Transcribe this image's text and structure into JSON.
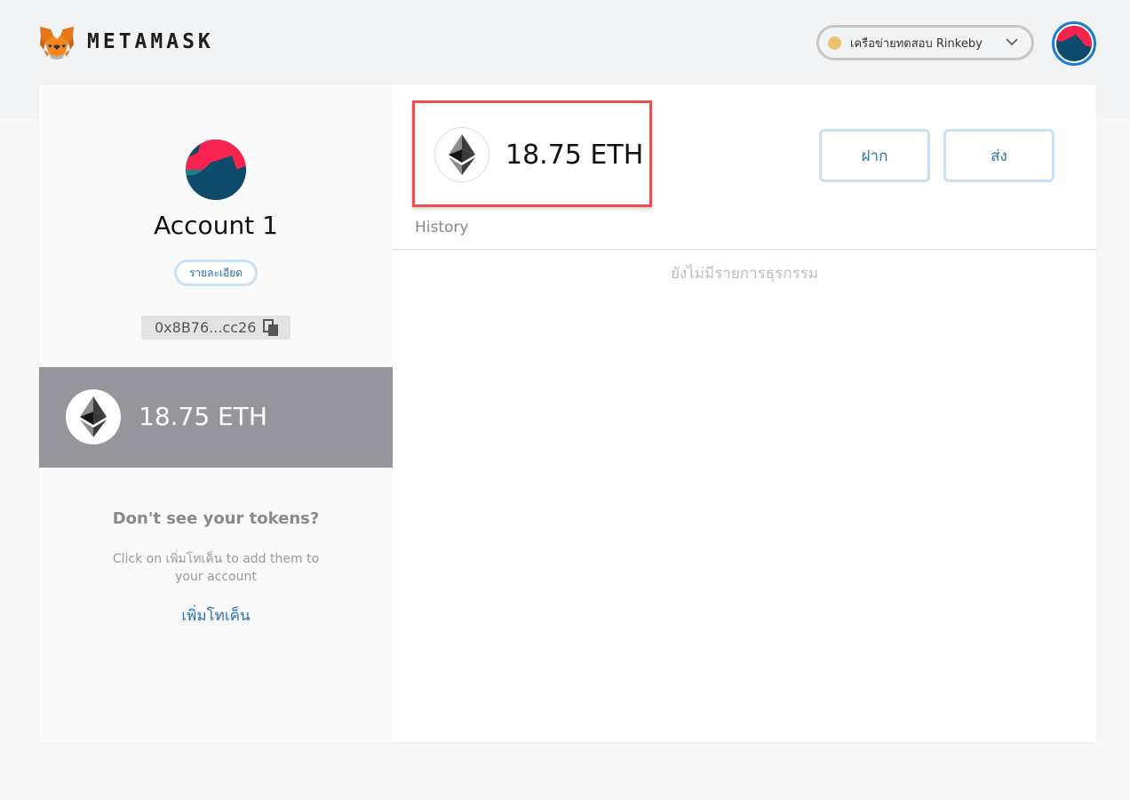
{
  "header": {
    "brand": "METAMASK",
    "logo_icon": "metamask-fox-icon",
    "network_label": "เครือข่ายทดสอบ Rinkeby",
    "network_dot_color": "#e8c471",
    "avatar_icon": "account-identicon"
  },
  "sidebar": {
    "account_name": "Account 1",
    "details_label": "รายละเอียด",
    "address": "0x8B76...cc26",
    "copy_icon": "copy-icon",
    "balance": "18.75 ETH",
    "tokens_title": "Don't see your tokens?",
    "tokens_desc": "Click on เพิ่มโทเค็น to add them to your account",
    "add_token_label": "เพิ่มโทเค็น"
  },
  "main": {
    "balance": "18.75 ETH",
    "deposit_label": "ฝาก",
    "send_label": "ส่ง",
    "history_label": "History",
    "empty_history": "ยังไม่มีรายการธุรกรรม"
  },
  "colors": {
    "accent_blue": "#2a73b5",
    "highlight_red": "#ef4c4c",
    "balance_bg": "#96959c"
  }
}
